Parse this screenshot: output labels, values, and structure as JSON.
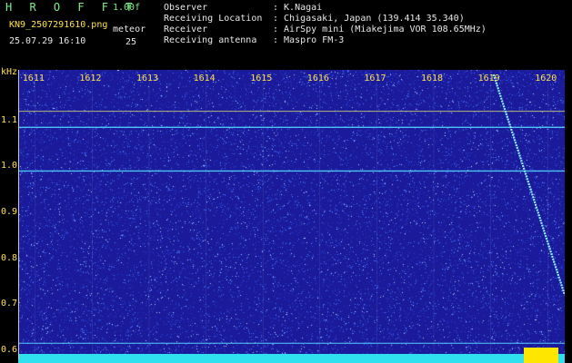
{
  "header": {
    "brand": "H R O F F T",
    "version": "1.00f",
    "filename": "KN9_2507291610.png",
    "timestamp": "25.07.29 16:10",
    "meteor_label": "meteor",
    "meteor_count": "25"
  },
  "meta": [
    {
      "key": "Observer",
      "value": ": K.Nagai"
    },
    {
      "key": "Receiving Location",
      "value": ": Chigasaki, Japan (139.414 35.340)"
    },
    {
      "key": "Receiver",
      "value": ": AirSpy mini (Miakejima VOR 108.65MHz)"
    },
    {
      "key": "Receiving antenna",
      "value": ": Maspro FM-3"
    }
  ],
  "chart_data": {
    "type": "heatmap",
    "ylabel": "kHz",
    "ylim": [
      0.58,
      1.21
    ],
    "y_ticks": [
      "1.1",
      "1.0",
      "0.9",
      "0.8",
      "0.7",
      "0.6"
    ],
    "x_ticks": [
      "1611",
      "1612",
      "1613",
      "1614",
      "1615",
      "1616",
      "1617",
      "1618",
      "1619",
      "1620"
    ],
    "xlim": [
      1610.7,
      1620.3
    ],
    "horizontal_lines_khz": [
      1.12,
      1.085,
      0.99,
      0.615
    ],
    "meteor_trail": {
      "x_start": 1619.05,
      "y_start": 1.2,
      "x_end": 1620.3,
      "y_end": 0.72
    },
    "colors": {
      "background": "#1a1a9a",
      "noise": "#4d7cff",
      "line": "#54d8ff",
      "floor": "#2fe0ee",
      "spike": "#ffe600"
    }
  }
}
